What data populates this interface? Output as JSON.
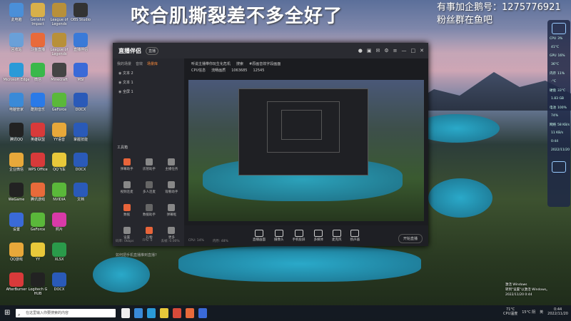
{
  "overlay": {
    "title": "咬合肌撕裂差不多全好了",
    "top_right_line1": "有事加企鹅号：1275776921",
    "top_right_line2": "粉丝群在鱼吧"
  },
  "desktop_icons": [
    {
      "label": "此电脑",
      "color": "#4a8fd8"
    },
    {
      "label": "Genshin Impact",
      "color": "#d8b04a"
    },
    {
      "label": "League of Legends",
      "color": "#b8903a"
    },
    {
      "label": "OBS Studio",
      "color": "#333"
    },
    {
      "label": "回收站",
      "color": "#6aa0d8"
    },
    {
      "label": "斗鱼直播",
      "color": "#e86a3a"
    },
    {
      "label": "League of Legends",
      "color": "#b8903a"
    },
    {
      "label": "直播伴侣",
      "color": "#3a7ad8"
    },
    {
      "label": "Microsoft Edge",
      "color": "#2a9ad8"
    },
    {
      "label": "微信",
      "color": "#3ab84a"
    },
    {
      "label": "Minecraft",
      "color": "#444"
    },
    {
      "label": "MSI",
      "color": "#3a6ad8"
    },
    {
      "label": "电脑管家",
      "color": "#3a8ad8"
    },
    {
      "label": "酷狗音乐",
      "color": "#2a7ae8"
    },
    {
      "label": "GeForce",
      "color": "#5ab83a"
    },
    {
      "label": "DOCX",
      "color": "#2a5ab8"
    },
    {
      "label": "腾讯QQ",
      "color": "#222"
    },
    {
      "label": "英雄联盟",
      "color": "#d83a3a"
    },
    {
      "label": "YY语音",
      "color": "#e8a83a"
    },
    {
      "label": "掌握技能",
      "color": "#2a5ab8"
    },
    {
      "label": "企业微信",
      "color": "#e8a83a"
    },
    {
      "label": "WPS Office",
      "color": "#d83a3a"
    },
    {
      "label": "QQ飞车",
      "color": "#e8c83a"
    },
    {
      "label": "DOCX",
      "color": "#2a5ab8"
    },
    {
      "label": "WeGame",
      "color": "#222"
    },
    {
      "label": "腾讯游戏",
      "color": "#e86a3a"
    },
    {
      "label": "NVIDIA",
      "color": "#5ab83a"
    },
    {
      "label": "文档",
      "color": "#2a5ab8"
    },
    {
      "label": "设置",
      "color": "#3a6ad8"
    },
    {
      "label": "GeForce",
      "color": "#5ab83a"
    },
    {
      "label": "照片",
      "color": "#d83aa8"
    },
    {
      "label": "",
      "color": "transparent"
    },
    {
      "label": "QQ游戏",
      "color": "#e8a83a"
    },
    {
      "label": "YY",
      "color": "#e8c83a"
    },
    {
      "label": "XLSX",
      "color": "#2a9a4a"
    },
    {
      "label": "",
      "color": "transparent"
    },
    {
      "label": "AfterBurner",
      "color": "#d83a3a"
    },
    {
      "label": "Logitech G HUB",
      "color": "#222"
    },
    {
      "label": "DOCX",
      "color": "#2a5ab8"
    },
    {
      "label": "",
      "color": "transparent"
    }
  ],
  "app": {
    "logo": "直播伴侣",
    "badge": "直播",
    "left_tabs": [
      "我的场景",
      "音效",
      "场景库"
    ],
    "active_tab_index": 2,
    "layers": [
      "文本 2",
      "文本 1",
      "全屏 1"
    ],
    "tools_label": "工具箱",
    "tools": [
      "弹幕助手",
      "房管助手",
      "主播任务",
      "视频连麦",
      "多人连麦",
      "观看助手",
      "数据",
      "数据助手",
      "弹幕框",
      "设置",
      "礼物",
      "更多"
    ],
    "bottom_left": "如何把手机直播推到直播?",
    "stream_title": "听说主播带你玩生化危机",
    "stream_tag": "搜索",
    "stream_category": "#原画音效字段画面",
    "info_items": [
      "CPU信息",
      "流畅画质",
      "1063685",
      "12545"
    ],
    "bottom_buttons": [
      "直播画面",
      "摄像头",
      "手机投屏",
      "多媒体",
      "麦克风",
      "扬声器"
    ],
    "start_label": "开始直播",
    "status_items": [
      "码率: 0kbps",
      "FPS: 0",
      "丢帧: 0.00%",
      "CPU: 14%",
      "内存: 48%"
    ]
  },
  "side_widget": {
    "rows": [
      {
        "label": "CPU",
        "value": "3%"
      },
      {
        "label": "",
        "value": "41°C"
      },
      {
        "label": "GPU",
        "value": "16%"
      },
      {
        "label": "",
        "value": "36°C"
      },
      {
        "label": "内存",
        "value": "11%"
      },
      {
        "label": "",
        "value": "-°C"
      },
      {
        "label": "硬盘",
        "value": "33°C"
      },
      {
        "label": "",
        "value": "1.83 GB"
      },
      {
        "label": "电池",
        "value": "100%"
      },
      {
        "label": "",
        "value": "74%"
      },
      {
        "label": "网络",
        "value": "58 KB/s"
      },
      {
        "label": "",
        "value": "11 KB/s"
      },
      {
        "label": "",
        "value": "0:44"
      },
      {
        "label": "",
        "value": "2022/11/20"
      }
    ]
  },
  "taskbar": {
    "search_placeholder": "在这里输入你要搜索的内容",
    "tray_temp": "71°C",
    "tray_cpu": "CPU温度",
    "weather": "15°C 阴",
    "lang": "英",
    "time": "0:44",
    "date": "2022/11/20",
    "app_colors": [
      "#eee",
      "#3a8ad8",
      "#2a9ad8",
      "#e8c83a",
      "#d84a3a",
      "#e86a3a",
      "#3a6ad8"
    ]
  },
  "notification": {
    "line1": "激活 Windows",
    "line2": "转到\"设置\"以激活 Windows。",
    "line3": "2022/11/20 0:44"
  }
}
